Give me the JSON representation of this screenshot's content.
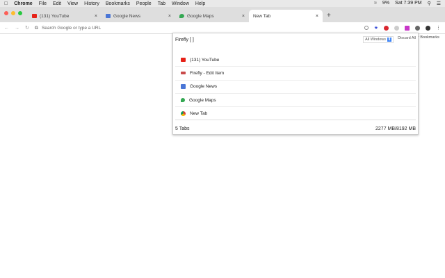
{
  "menubar": {
    "app": "Chrome",
    "items": [
      "File",
      "Edit",
      "View",
      "History",
      "Bookmarks",
      "People",
      "Tab",
      "Window",
      "Help"
    ],
    "battery": "9%",
    "clock": "Sat 7:39 PM"
  },
  "tabs": [
    {
      "label": "(131) YouTube",
      "color": "#e62117"
    },
    {
      "label": "Google News",
      "color": "#4a76d6"
    },
    {
      "label": "Google Maps",
      "color": "#34a853"
    },
    {
      "label": "New Tab",
      "color": ""
    }
  ],
  "toolbar": {
    "omnibox_placeholder": "Search Google or type a URL"
  },
  "bookmarks_label": "r Bookmarks",
  "popup": {
    "title": "Firefly [ ]",
    "window_select": "All Windows",
    "discard_all": "Discard All",
    "items": [
      {
        "title": "(131) YouTube",
        "color": "#e62117"
      },
      {
        "title": "Firefly - Edit Item",
        "color": "#c94a4a"
      },
      {
        "title": "Google News",
        "color": "#4a76d6"
      },
      {
        "title": "Google Maps",
        "color": "#34a853"
      },
      {
        "title": "New Tab",
        "color": "#db4437"
      }
    ],
    "tab_count": "5 Tabs",
    "memory": "2277 MB/8192 MB"
  }
}
